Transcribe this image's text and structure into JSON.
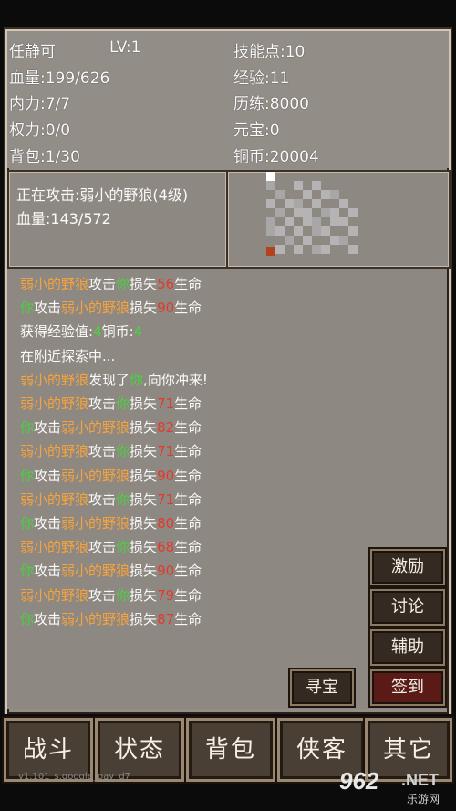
{
  "stats": {
    "name": "任静可",
    "level": "LV:1",
    "skill_points": "技能点:10",
    "hp": "血量:199/626",
    "exp": "经验:11",
    "mp": "内力:7/7",
    "training": "历练:8000",
    "power": "权力:0/0",
    "yuanbao": "元宝:0",
    "bag": "背包:1/30",
    "coins": "铜币:20004"
  },
  "combat": {
    "target": "正在攻击:弱小的野狼(4级)",
    "target_hp": "血量:143/572"
  },
  "log": [
    {
      "parts": [
        {
          "t": "弱小的野狼",
          "c": "orange"
        },
        {
          "t": "攻击",
          "c": "white"
        },
        {
          "t": "你",
          "c": "green"
        },
        {
          "t": "损失",
          "c": "white"
        },
        {
          "t": "56",
          "c": "red"
        },
        {
          "t": "生命",
          "c": "white"
        }
      ]
    },
    {
      "parts": [
        {
          "t": "你",
          "c": "green"
        },
        {
          "t": "攻击",
          "c": "white"
        },
        {
          "t": "弱小的野狼",
          "c": "orange"
        },
        {
          "t": "损失",
          "c": "white"
        },
        {
          "t": "90",
          "c": "red"
        },
        {
          "t": "生命",
          "c": "white"
        }
      ]
    },
    {
      "parts": [
        {
          "t": "获得经验值:",
          "c": "white"
        },
        {
          "t": "4",
          "c": "green"
        },
        {
          "t": "铜币:",
          "c": "white"
        },
        {
          "t": "4",
          "c": "green"
        }
      ]
    },
    {
      "parts": [
        {
          "t": "在附近探索中...",
          "c": "white"
        }
      ]
    },
    {
      "parts": [
        {
          "t": "弱小的野狼",
          "c": "orange"
        },
        {
          "t": "发现了",
          "c": "white"
        },
        {
          "t": "你",
          "c": "green"
        },
        {
          "t": ",向你冲来!",
          "c": "white"
        }
      ]
    },
    {
      "parts": [
        {
          "t": "弱小的野狼",
          "c": "orange"
        },
        {
          "t": "攻击",
          "c": "white"
        },
        {
          "t": "你",
          "c": "green"
        },
        {
          "t": "损失",
          "c": "white"
        },
        {
          "t": "71",
          "c": "red"
        },
        {
          "t": "生命",
          "c": "white"
        }
      ]
    },
    {
      "parts": [
        {
          "t": "你",
          "c": "green"
        },
        {
          "t": "攻击",
          "c": "white"
        },
        {
          "t": "弱小的野狼",
          "c": "orange"
        },
        {
          "t": "损失",
          "c": "white"
        },
        {
          "t": "82",
          "c": "red"
        },
        {
          "t": "生命",
          "c": "white"
        }
      ]
    },
    {
      "parts": [
        {
          "t": "弱小的野狼",
          "c": "orange"
        },
        {
          "t": "攻击",
          "c": "white"
        },
        {
          "t": "你",
          "c": "green"
        },
        {
          "t": "损失",
          "c": "white"
        },
        {
          "t": "71",
          "c": "red"
        },
        {
          "t": "生命",
          "c": "white"
        }
      ]
    },
    {
      "parts": [
        {
          "t": "你",
          "c": "green"
        },
        {
          "t": "攻击",
          "c": "white"
        },
        {
          "t": "弱小的野狼",
          "c": "orange"
        },
        {
          "t": "损失",
          "c": "white"
        },
        {
          "t": "90",
          "c": "red"
        },
        {
          "t": "生命",
          "c": "white"
        }
      ]
    },
    {
      "parts": [
        {
          "t": "弱小的野狼",
          "c": "orange"
        },
        {
          "t": "攻击",
          "c": "white"
        },
        {
          "t": "你",
          "c": "green"
        },
        {
          "t": "损失",
          "c": "white"
        },
        {
          "t": "71",
          "c": "red"
        },
        {
          "t": "生命",
          "c": "white"
        }
      ]
    },
    {
      "parts": [
        {
          "t": "你",
          "c": "green"
        },
        {
          "t": "攻击",
          "c": "white"
        },
        {
          "t": "弱小的野狼",
          "c": "orange"
        },
        {
          "t": "损失",
          "c": "white"
        },
        {
          "t": "80",
          "c": "red"
        },
        {
          "t": "生命",
          "c": "white"
        }
      ]
    },
    {
      "parts": [
        {
          "t": "弱小的野狼",
          "c": "orange"
        },
        {
          "t": "攻击",
          "c": "white"
        },
        {
          "t": "你",
          "c": "green"
        },
        {
          "t": "损失",
          "c": "white"
        },
        {
          "t": "68",
          "c": "red"
        },
        {
          "t": "生命",
          "c": "white"
        }
      ]
    },
    {
      "parts": [
        {
          "t": "你",
          "c": "green"
        },
        {
          "t": "攻击",
          "c": "white"
        },
        {
          "t": "弱小的野狼",
          "c": "orange"
        },
        {
          "t": "损失",
          "c": "white"
        },
        {
          "t": "90",
          "c": "red"
        },
        {
          "t": "生命",
          "c": "white"
        }
      ]
    },
    {
      "parts": [
        {
          "t": "弱小的野狼",
          "c": "orange"
        },
        {
          "t": "攻击",
          "c": "white"
        },
        {
          "t": "你",
          "c": "green"
        },
        {
          "t": "损失",
          "c": "white"
        },
        {
          "t": "79",
          "c": "red"
        },
        {
          "t": "生命",
          "c": "white"
        }
      ]
    },
    {
      "parts": [
        {
          "t": "你",
          "c": "green"
        },
        {
          "t": "攻击",
          "c": "white"
        },
        {
          "t": "弱小的野狼",
          "c": "orange"
        },
        {
          "t": "损失",
          "c": "white"
        },
        {
          "t": "87",
          "c": "red"
        },
        {
          "t": "生命",
          "c": "white"
        }
      ]
    }
  ],
  "side_buttons": {
    "inspire": "激励",
    "discuss": "讨论",
    "assist": "辅助",
    "treasure": "寻宝",
    "checkin": "签到"
  },
  "tabs": {
    "battle": "战斗",
    "status": "状态",
    "bag": "背包",
    "hero": "侠客",
    "other": "其它"
  },
  "version": "v1.101_s.google_pay_d7",
  "watermark": {
    "num": "962",
    "net": ".NET",
    "sub": "乐游网"
  },
  "colors": {
    "panel": "#8e8882",
    "enemy_name": "#f7a33b",
    "player_name": "#45d63a",
    "damage": "#e23b2b"
  }
}
